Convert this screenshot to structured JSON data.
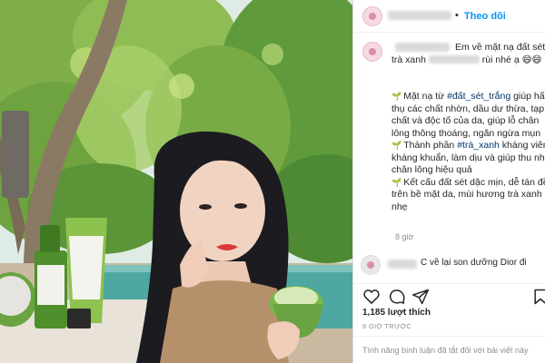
{
  "post": {
    "follow_label": "Theo dõi",
    "dot": "•",
    "caption": {
      "intro_a": "Em về mặt nạ đất sét",
      "intro_b_start": "trà xanh",
      "intro_b_end": "rùi nhé ạ 😄😄",
      "b1_pre": "Mặt nạ từ ",
      "b1_tag": "#đất_sét_trắng",
      "b1_post": " giúp hấp",
      "b1_l2": "thụ các chất nhờn, dầu dư thừa, tạp",
      "b1_l3": "chất và độc tố của da, giúp lỗ chân",
      "b1_l4": "lông thông thoáng, ngăn ngừa mụn",
      "b2_pre": "Thành phần ",
      "b2_tag": "#trà_xanh",
      "b2_post": " kháng viêm,",
      "b2_l2": "kháng khuẩn, làm dịu và giúp thu nhỏ",
      "b2_l3": "chân lông hiệu quả",
      "b3_l1": "Kết cấu đất sét dặc mịn, dễ tán đều",
      "b3_l2": "trên bề mặt da, mùi hương trà xanh dịu",
      "b3_l3": "nhẹ",
      "sprout": "🌱"
    },
    "caption_time": "8 giờ",
    "comment_text": "C về lại son dưỡng Dior đi",
    "likes": "1,185 lượt thích",
    "post_time": "8 GIỜ TRƯỚC",
    "comments_disabled": "Tính năng bình luận đã tắt đối với bài viết này",
    "icons": {
      "like": "heart-icon",
      "comment": "comment-icon",
      "share": "send-icon",
      "save": "bookmark-icon"
    },
    "colors": {
      "follow": "#0095f6",
      "hashtag": "#00376b",
      "muted": "#8e8e8e",
      "text": "#262626"
    }
  }
}
